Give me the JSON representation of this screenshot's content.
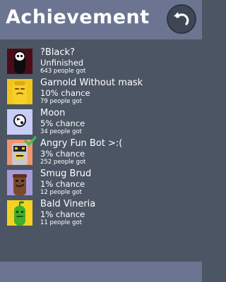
{
  "header": {
    "title": "Achievement",
    "back_icon": "back-arrow-icon"
  },
  "achievements": [
    {
      "name": "?Black?",
      "chance": "Unfinished",
      "got": "643 people got",
      "icon": "black-character",
      "completed": false
    },
    {
      "name": "Garnold Without mask",
      "chance": "10% chance",
      "got": "79 people got",
      "icon": "garnold-character",
      "completed": false
    },
    {
      "name": "Moon",
      "chance": "5% chance",
      "got": "34 people got",
      "icon": "moon-character",
      "completed": false
    },
    {
      "name": "Angry Fun Bot >:(",
      "chance": "3% chance",
      "got": "252 people got",
      "icon": "funbot-character",
      "completed": true
    },
    {
      "name": "Smug Brud",
      "chance": "1% chance",
      "got": "12 people got",
      "icon": "brud-character",
      "completed": false
    },
    {
      "name": "Bald Vineria",
      "chance": "1% chance",
      "got": "11 people got",
      "icon": "vineria-character",
      "completed": false
    }
  ],
  "colors": {
    "header": "#6b7591",
    "background": "#4b5563",
    "check": "#39c24a"
  }
}
